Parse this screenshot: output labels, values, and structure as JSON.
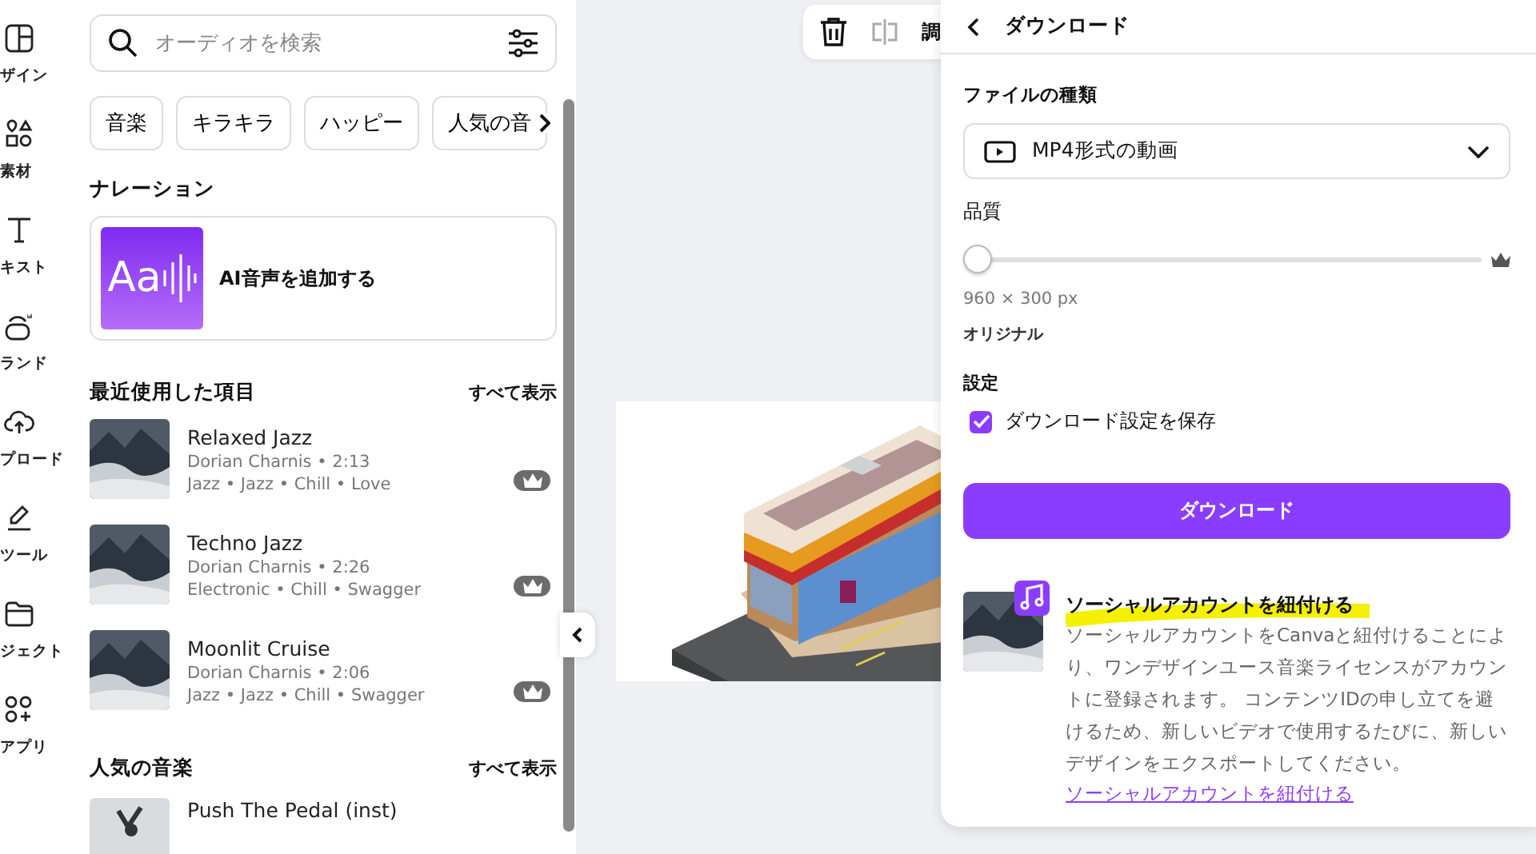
{
  "nav_rail": [
    {
      "label": "ザイン"
    },
    {
      "label": "素材"
    },
    {
      "label": "キスト"
    },
    {
      "label": "ランド"
    },
    {
      "label": "プロード"
    },
    {
      "label": "ツール"
    },
    {
      "label": "ジェクト"
    },
    {
      "label": "アプリ"
    }
  ],
  "search": {
    "placeholder": "オーディオを検索"
  },
  "chips": [
    "音楽",
    "キラキラ",
    "ハッピー",
    "人気の音"
  ],
  "narration": {
    "heading": "ナレーション",
    "card_label": "AI音声を追加する",
    "thumb_text": "Aa"
  },
  "recent": {
    "heading": "最近使用した項目",
    "see_all": "すべて表示",
    "tracks": [
      {
        "title": "Relaxed Jazz",
        "meta": "Dorian Charnis • 2:13",
        "tags": "Jazz • Jazz • Chill • Love",
        "premium": true
      },
      {
        "title": "Techno Jazz",
        "meta": "Dorian Charnis • 2:26",
        "tags": "Electronic • Chill • Swagger",
        "premium": true
      },
      {
        "title": "Moonlit Cruise",
        "meta": "Dorian Charnis • 2:06",
        "tags": "Jazz • Jazz • Chill • Swagger",
        "premium": true
      }
    ]
  },
  "popular": {
    "heading": "人気の音楽",
    "see_all": "すべて表示",
    "tracks": [
      {
        "title": "Push The Pedal (inst)"
      }
    ]
  },
  "toolbar": {
    "cut_label": "調"
  },
  "download_panel": {
    "title": "ダウンロード",
    "file_type_label": "ファイルの種類",
    "file_type": "MP4形式の動画",
    "quality_label": "品質",
    "quality": {
      "level": 0
    },
    "size": "960 × 300 px",
    "quality_name": "オリジナル",
    "settings_label": "設定",
    "save_settings": {
      "label": "ダウンロード設定を保存",
      "checked": true
    },
    "download_button": "ダウンロード",
    "social": {
      "title": "ソーシャルアカウントを紐付ける",
      "highlighted": true,
      "body": "ソーシャルアカウントをCanvaと紐付けることにより、ワンデザインユース音楽ライセンスがアカウントに登録されます。 コンテンツIDの申し立てを避けるため、新しいビデオで使用するたびに、新しいデザインをエクスポートしてください。",
      "link": "ソーシャルアカウントを紐付ける"
    }
  }
}
